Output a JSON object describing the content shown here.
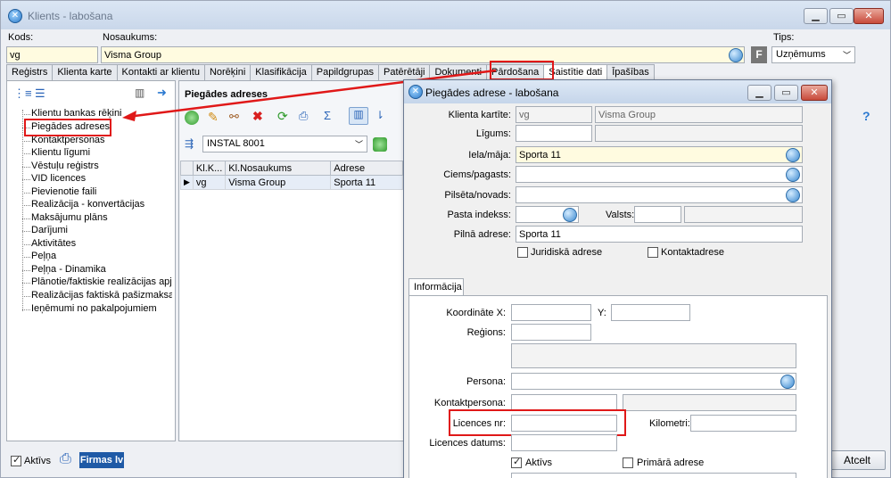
{
  "window": {
    "title": "Klients - labošana",
    "min": "▁",
    "max": "▭",
    "close": "✕"
  },
  "header": {
    "kods_label": "Kods:",
    "kods_value": "vg",
    "nosaukums_label": "Nosaukums:",
    "nosaukums_value": "Visma Group",
    "f_label": "F",
    "tips_label": "Tips:",
    "tips_value": "Uzņēmums"
  },
  "tabs": [
    "Reģistrs",
    "Klienta karte",
    "Kontakti ar klientu",
    "Norēķini",
    "Klasifikācija",
    "Papildgrupas",
    "Patērētāji",
    "Dokumenti",
    "Pārdošana",
    "Saistītie dati",
    "Īpašības"
  ],
  "active_tab_index": 9,
  "tree": {
    "items": [
      "Klientu bankas rēķini",
      "Piegādes adreses",
      "Kontaktpersonas",
      "Klientu līgumi",
      "Vēstuļu reģistrs",
      "VID licences",
      "Pievienotie faili",
      "Realizācija - konvertācijas",
      "Maksājumu plāns",
      "Darījumi",
      "Aktivitātes",
      "Peļņa",
      "Peļņa - Dinamika",
      "Plānotie/faktiskie realizācijas apjomi",
      "Realizācijas faktiskā pašizmaksa - Di",
      "Ieņēmumi no pakalpojumiem"
    ],
    "selected_index": 1
  },
  "middle": {
    "title": "Piegādes adreses",
    "filter_value": "INSTAL 8001",
    "columns": [
      "Kl.K...",
      "Kl.Nosaukums",
      "Adrese"
    ],
    "rows": [
      [
        "vg",
        "Visma Group",
        "Sporta 11"
      ]
    ]
  },
  "dialog": {
    "title": "Piegādes adrese - labošana",
    "klienta_kartite_label": "Klienta kartīte:",
    "klienta_kods": "vg",
    "klienta_nosaukums": "Visma Group",
    "ligums_label": "Līgums:",
    "iela_label": "Iela/māja:",
    "iela_value": "Sporta 11",
    "ciems_label": "Ciems/pagasts:",
    "pilseta_label": "Pilsēta/novads:",
    "pasta_label": "Pasta indekss:",
    "valsts_label": "Valsts:",
    "pilna_label": "Pilnā adrese:",
    "pilna_value": "Sporta 11",
    "juridiska_label": "Juridiskā adrese",
    "kontaktadrese_label": "Kontaktadrese",
    "tab_informacija": "Informācija",
    "koord_x_label": "Koordināte X:",
    "y_label": "Y:",
    "regions_label": "Reģions:",
    "persona_label": "Persona:",
    "kontaktpersona_label": "Kontaktpersona:",
    "licences_nr_label": "Licences nr:",
    "kilometri_label": "Kilometri:",
    "licences_datums_label": "Licences datums:",
    "aktivs_label": "Aktīvs",
    "primara_label": "Primārā adrese"
  },
  "footer": {
    "aktivs_label": "Aktīvs",
    "firmas_label": "Firmas lv",
    "atcelt_label": "Atcelt"
  }
}
